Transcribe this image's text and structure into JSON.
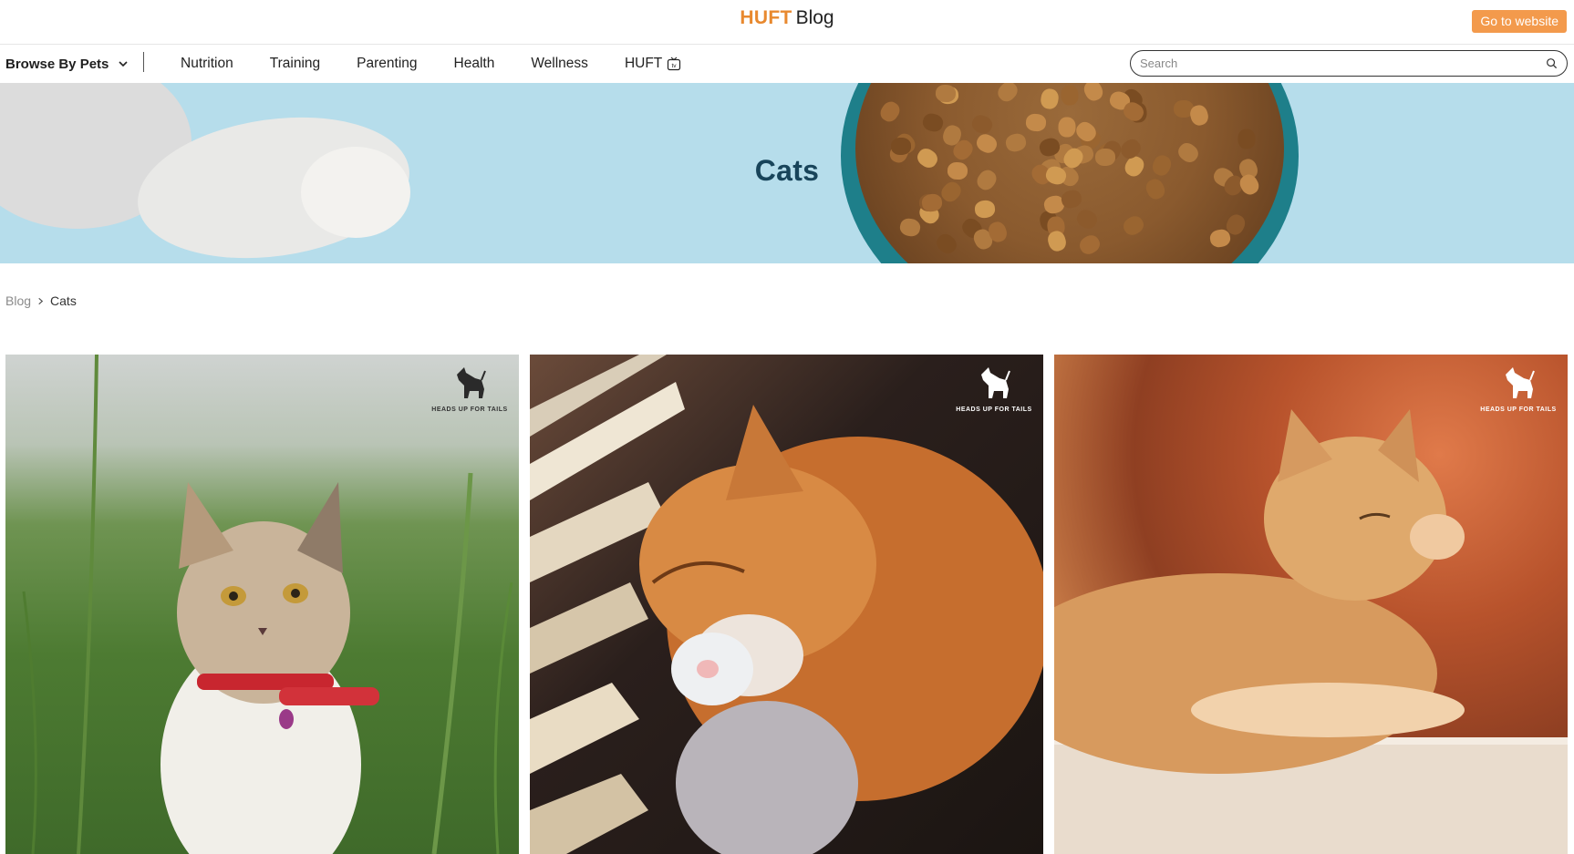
{
  "header": {
    "brand": "HUFT",
    "title": "Blog",
    "cta_label": "Go to website",
    "brand_color": "#e8892f",
    "cta_color": "#f39a4c"
  },
  "nav": {
    "browse_label": "Browse By Pets",
    "browse_icon": "chevron-down-icon",
    "links": [
      {
        "label": "Nutrition"
      },
      {
        "label": "Training"
      },
      {
        "label": "Parenting"
      },
      {
        "label": "Health"
      },
      {
        "label": "Wellness"
      },
      {
        "label": "HUFT",
        "icon": "tv-icon"
      }
    ],
    "search_placeholder": "Search",
    "search_icon": "search-icon"
  },
  "hero": {
    "title": "Cats",
    "background_color": "#b6ddeb",
    "title_color": "#18445a"
  },
  "breadcrumb": {
    "home": "Blog",
    "separator_icon": "chevron-right-icon",
    "current": "Cats"
  },
  "cards": [
    {
      "image": "calico kitten in tall grass with red harness",
      "watermark": "HEADS UP FOR TAILS",
      "icon": "dog-logo-icon"
    },
    {
      "image": "orange fluffy cat sleeping hugging a plush toy on a patterned rug",
      "watermark": "HEADS UP FOR TAILS",
      "icon": "dog-logo-icon"
    },
    {
      "image": "orange tabby cat resting on a ledge with autumn bokeh",
      "watermark": "HEADS UP FOR TAILS",
      "icon": "dog-logo-icon"
    }
  ]
}
